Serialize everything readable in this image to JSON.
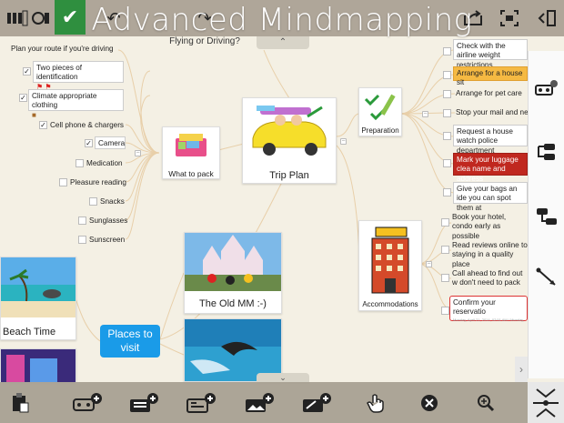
{
  "title": "Advanced Mindmapping",
  "top_tab_label": "Flying or Driving?",
  "colors": {
    "accent_blue": "#1a9be8",
    "orange": "#f5b942",
    "red": "#c0281f",
    "green_tab": "#2f8f3f"
  },
  "left_items": [
    {
      "label": "Plan your route if you're driving",
      "checked": false
    },
    {
      "label": "Two pieces of identification",
      "checked": true
    },
    {
      "label": "Climate appropriate clothing",
      "checked": true
    },
    {
      "label": "Cell phone & chargers",
      "checked": true
    },
    {
      "label": "Camera",
      "checked": true
    },
    {
      "label": "Medication",
      "checked": false
    },
    {
      "label": "Pleasure reading",
      "checked": false
    },
    {
      "label": "Snacks",
      "checked": false
    },
    {
      "label": "Sunglasses",
      "checked": false
    },
    {
      "label": "Sunscreen",
      "checked": false
    }
  ],
  "nodes": {
    "what_to_pack": "What to pack",
    "trip_plan": "Trip Plan",
    "preparation": "Preparation",
    "accommodations": "Accommodations",
    "old_mm": "The Old MM :-)",
    "beach_time": "Beach Time",
    "places_to_visit": "Places to visit"
  },
  "preparation_items": [
    "Check with the airline weight restrictions",
    "Arrange for a house sit",
    "Arrange for pet care",
    "Stop your mail and new",
    "Request a house watch police department",
    "Mark your luggage clea name and address",
    "Give your bags an ide you can spot them at"
  ],
  "accommodation_items": [
    "Book your hotel, condo early as possible",
    "Read reviews online to staying in a quality place",
    "Call ahead to find out w don't need to pack",
    "Confirm your reservatio"
  ],
  "confirm_subtext": "Monday, April 21, 2014, 02:51 AM / Monday, April 21, 2014, 02:51 AM",
  "icons": {
    "top": [
      "battery-icon",
      "checkmark-icon",
      "undo-icon",
      "share-icon",
      "fit-screen-icon",
      "collapse-panel-icon"
    ],
    "right": [
      "topic-info-icon",
      "topic-style-icon",
      "layout-icon",
      "connection-icon"
    ],
    "bottom": [
      "paste-icon",
      "add-topic-icon",
      "add-note-icon",
      "add-textbox-icon",
      "add-image-icon",
      "add-link-icon",
      "touch-mode-icon",
      "delete-icon",
      "zoom-icon",
      "collapse-all-icon"
    ]
  }
}
